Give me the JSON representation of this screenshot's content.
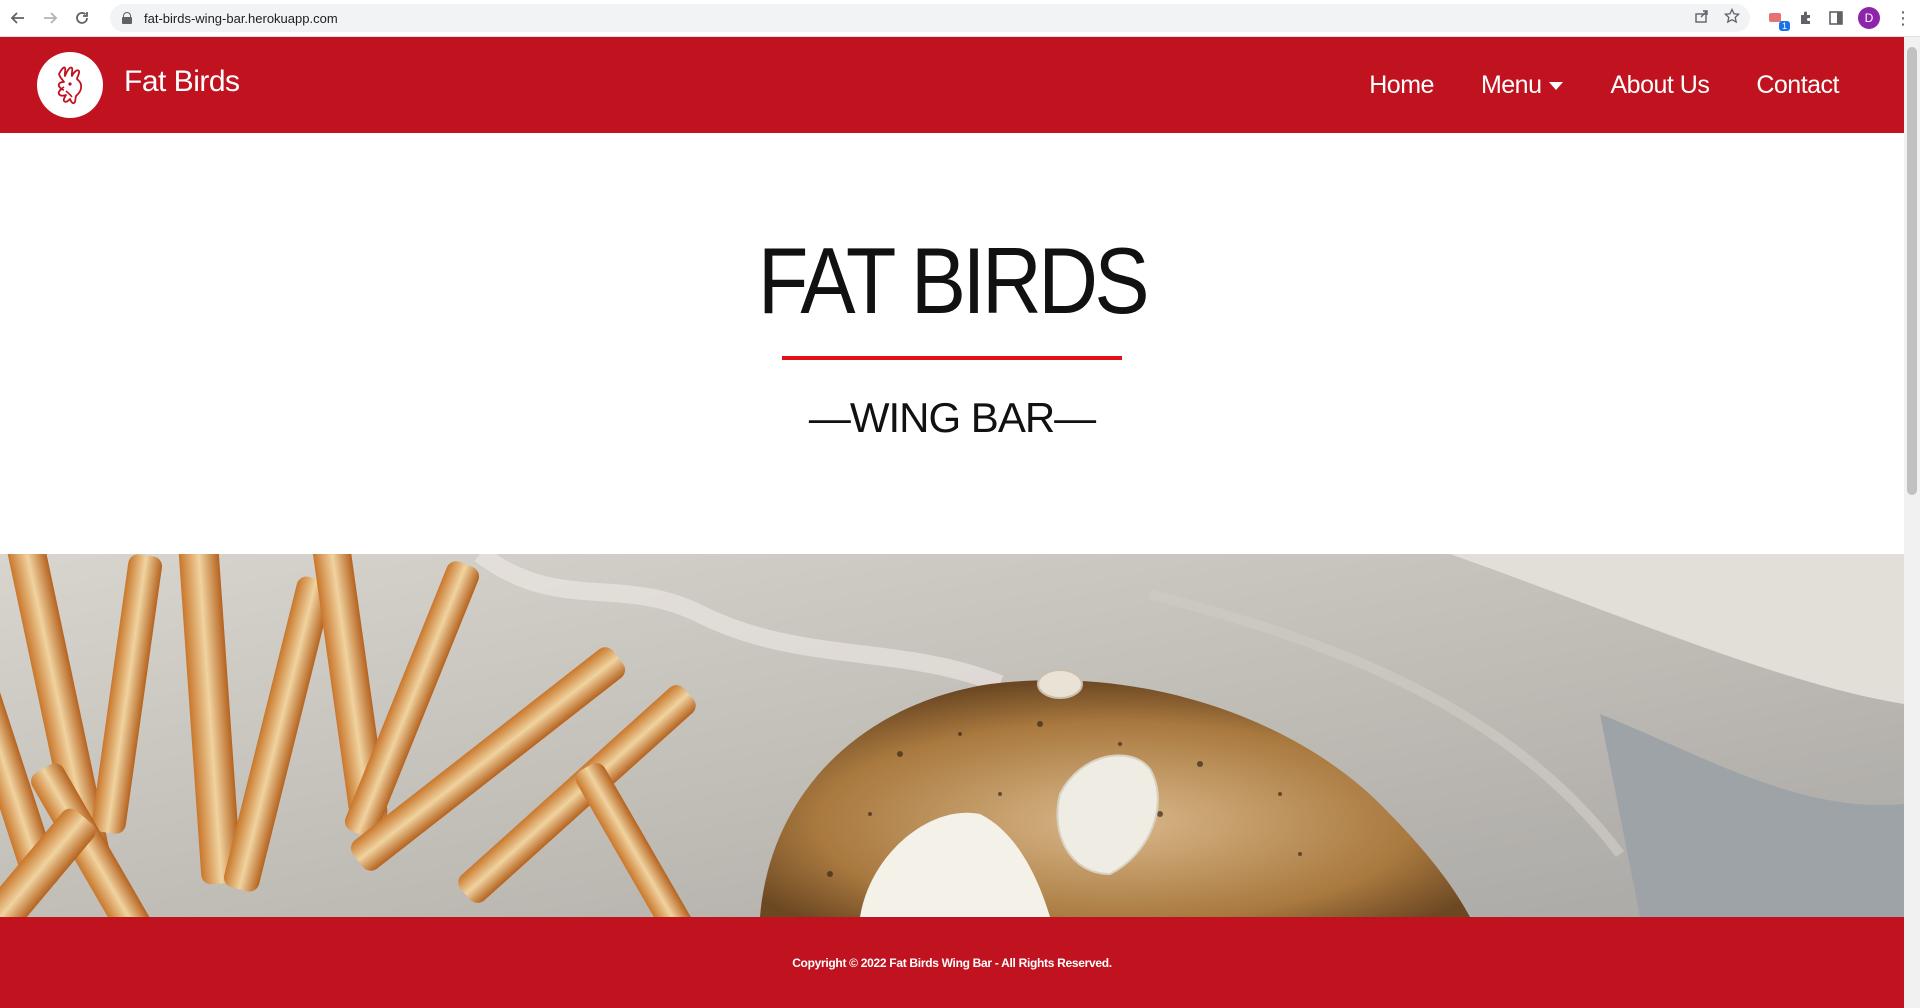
{
  "browser": {
    "url": "fat-birds-wing-bar.herokuapp.com",
    "extension_badge": "1",
    "profile_initial": "D"
  },
  "navbar": {
    "brand": "Fat Birds",
    "links": [
      {
        "label": "Home"
      },
      {
        "label": "Menu",
        "has_dropdown": true
      },
      {
        "label": "About Us"
      },
      {
        "label": "Contact"
      }
    ],
    "background_color": "#c1121f"
  },
  "hero": {
    "title": "FAT BIRDS",
    "subtitle": "—WING BAR—",
    "rule_color": "#e3101b"
  },
  "footer": {
    "copyright": "Copyright © 2022 Fat Birds Wing Bar - All Rights Reserved."
  },
  "icons": {
    "logo": "rooster-logo-icon",
    "back": "arrow-left-icon",
    "forward": "arrow-right-icon",
    "reload": "reload-icon",
    "lock": "lock-icon",
    "share": "share-icon",
    "bookmark": "star-icon",
    "extension": "extension-icon",
    "puzzle": "puzzle-icon",
    "side_panel": "side-panel-icon",
    "menu": "kebab-icon",
    "dropdown": "caret-down-icon"
  }
}
